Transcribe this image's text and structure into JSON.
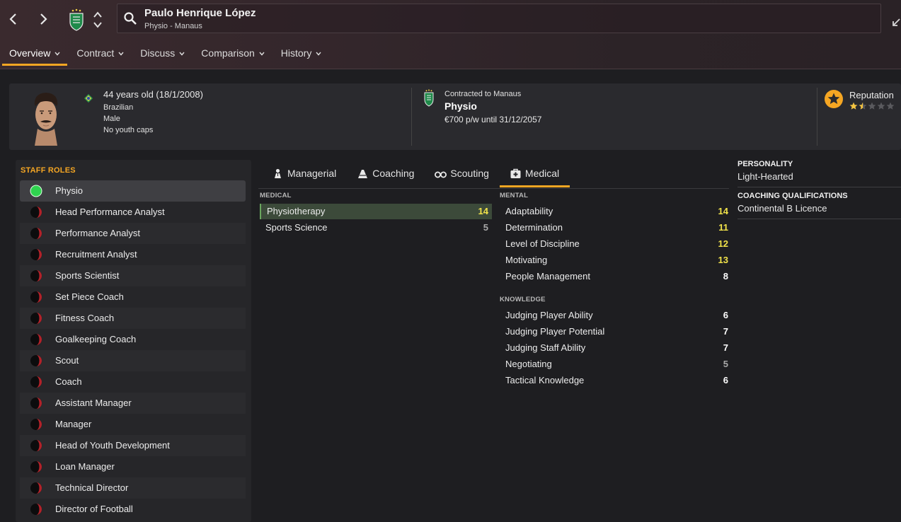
{
  "header": {
    "name": "Paulo Henrique López",
    "subtitle": "Physio - Manaus",
    "tabs": [
      {
        "label": "Overview"
      },
      {
        "label": "Contract"
      },
      {
        "label": "Discuss"
      },
      {
        "label": "Comparison"
      },
      {
        "label": "History"
      }
    ],
    "active_tab": "Overview",
    "accent_color": "#f5a623"
  },
  "profile": {
    "age": "44 years old (18/1/2008)",
    "nationality": "Brazilian",
    "gender": "Male",
    "youth_caps": "No youth caps",
    "contract_label": "Contracted to Manaus",
    "role": "Physio",
    "wage": "€700 p/w until 31/12/2057",
    "reputation_label": "Reputation",
    "reputation_stars": 1.5,
    "reputation_max": 5
  },
  "staff_roles": {
    "title": "STAFF ROLES",
    "items": [
      {
        "label": "Physio",
        "active": true
      },
      {
        "label": "Head Performance Analyst",
        "active": false
      },
      {
        "label": "Performance Analyst",
        "active": false
      },
      {
        "label": "Recruitment Analyst",
        "active": false
      },
      {
        "label": "Sports Scientist",
        "active": false
      },
      {
        "label": "Set Piece Coach",
        "active": false
      },
      {
        "label": "Fitness Coach",
        "active": false
      },
      {
        "label": "Goalkeeping Coach",
        "active": false
      },
      {
        "label": "Scout",
        "active": false
      },
      {
        "label": "Coach",
        "active": false
      },
      {
        "label": "Assistant Manager",
        "active": false
      },
      {
        "label": "Manager",
        "active": false
      },
      {
        "label": "Head of Youth Development",
        "active": false
      },
      {
        "label": "Loan Manager",
        "active": false
      },
      {
        "label": "Technical Director",
        "active": false
      },
      {
        "label": "Director of Football",
        "active": false
      }
    ]
  },
  "attr_tabs": [
    {
      "label": "Managerial",
      "icon": "managerial-icon"
    },
    {
      "label": "Coaching",
      "icon": "coaching-icon"
    },
    {
      "label": "Scouting",
      "icon": "binoculars-icon"
    },
    {
      "label": "Medical",
      "icon": "medical-kit-icon"
    }
  ],
  "active_attr_tab": "Medical",
  "medical": {
    "title": "MEDICAL",
    "items": [
      {
        "name": "Physiotherapy",
        "value": "14",
        "tone": "yellow",
        "highlight": true
      },
      {
        "name": "Sports Science",
        "value": "5",
        "tone": "grey",
        "highlight": false
      }
    ]
  },
  "mental": {
    "title": "MENTAL",
    "items": [
      {
        "name": "Adaptability",
        "value": "14",
        "tone": "yellow"
      },
      {
        "name": "Determination",
        "value": "11",
        "tone": "yellow"
      },
      {
        "name": "Level of Discipline",
        "value": "12",
        "tone": "yellow"
      },
      {
        "name": "Motivating",
        "value": "13",
        "tone": "yellow"
      },
      {
        "name": "People Management",
        "value": "8",
        "tone": "white"
      }
    ]
  },
  "knowledge": {
    "title": "KNOWLEDGE",
    "items": [
      {
        "name": "Judging Player Ability",
        "value": "6",
        "tone": "white"
      },
      {
        "name": "Judging Player Potential",
        "value": "7",
        "tone": "white"
      },
      {
        "name": "Judging Staff Ability",
        "value": "7",
        "tone": "white"
      },
      {
        "name": "Negotiating",
        "value": "5",
        "tone": "grey"
      },
      {
        "name": "Tactical Knowledge",
        "value": "6",
        "tone": "white"
      }
    ]
  },
  "personality": {
    "personality_title": "PERSONALITY",
    "personality_value": "Light-Hearted",
    "qualifications_title": "COACHING QUALIFICATIONS",
    "qualifications_value": "Continental B Licence"
  }
}
